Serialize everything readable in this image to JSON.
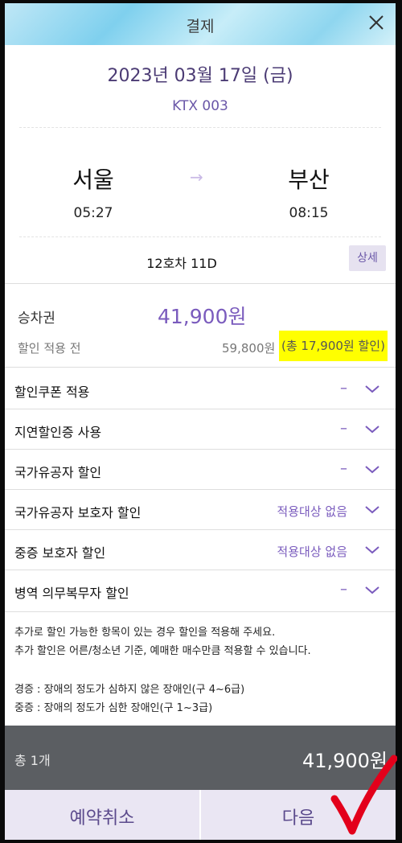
{
  "header": {
    "title": "결제",
    "close_icon": "close-icon"
  },
  "journey": {
    "date": "2023년 03월 17일 (금)",
    "train": "KTX 003",
    "departure": {
      "station": "서울",
      "time": "05:27"
    },
    "arrival": {
      "station": "부산",
      "time": "08:15"
    },
    "arrow": "→",
    "seat": "12호차 11D",
    "detail_label": "상세"
  },
  "fare": {
    "ticket_label": "승차권",
    "ticket_price": "41,900원",
    "before_label": "할인 적용 전",
    "before_price": "59,800원",
    "discount_total": "(총 17,900원 할인)"
  },
  "options": [
    {
      "label": "할인쿠폰 적용",
      "value": "–"
    },
    {
      "label": "지연할인증 사용",
      "value": "–"
    },
    {
      "label": "국가유공자 할인",
      "value": "–"
    },
    {
      "label": "국가유공자 보호자 할인",
      "value": "적용대상 없음"
    },
    {
      "label": "중증 보호자 할인",
      "value": "적용대상 없음"
    },
    {
      "label": "병역 의무복무자 할인",
      "value": "–"
    }
  ],
  "notice": {
    "line1": "추가로 할인 가능한 항목이 있는 경우 할인을 적용해 주세요.",
    "line2": "추가 할인은 어른/청소년 기준, 예매한 매수만큼 적용할 수 있습니다.",
    "line3": "경증 : 장애의 정도가 심하지 않은 장애인(구 4~6급)",
    "line4": "중증 : 장애의 정도가 심한 장애인(구 1~3급)"
  },
  "total": {
    "count": "총 1개",
    "price": "41,900원"
  },
  "buttons": {
    "cancel": "예약취소",
    "next": "다음"
  },
  "colors": {
    "accent": "#7a5bbd",
    "highlight": "#ffff00",
    "check": "#e3001b"
  }
}
